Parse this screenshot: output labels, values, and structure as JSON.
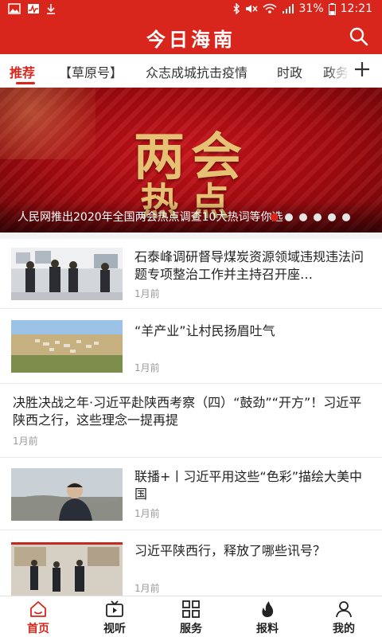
{
  "status_bar": {
    "battery": "31%",
    "time": "12:21"
  },
  "app": {
    "title": "今日海南"
  },
  "tabs": [
    {
      "label": "推荐",
      "active": true
    },
    {
      "label": "【草原号】"
    },
    {
      "label": "众志成城抗击疫情"
    },
    {
      "label": "时政"
    },
    {
      "label": "政务"
    }
  ],
  "banner": {
    "headline_line1": "两会",
    "headline_line2": "热点",
    "caption": "人民网推出2020年全国两会热点调查10大热词等你选",
    "slide_count": 6,
    "active_slide": 0
  },
  "news": [
    {
      "title": "石泰峰调研督导煤炭资源领域违规违法问题专项整治工作并主持召开座…",
      "time": "1月前",
      "thumb": "meeting-photo"
    },
    {
      "title": "“羊产业”让村民扬眉吐气",
      "time": "1月前",
      "thumb": "village-aerial-photo"
    },
    {
      "title": "决胜决战之年·习近平赴陕西考察（四）“鼓劲”“开方”！习近平陕西之行，这些理念一提再提",
      "time": "1月前",
      "thumb": null
    },
    {
      "title": "联播+丨习近平用这些“色彩”描绘大美中国",
      "time": "1月前",
      "thumb": "portrait-photo"
    },
    {
      "title": "习近平陕西行，释放了哪些讯号？",
      "time": "1月前",
      "thumb": "exhibition-photo"
    }
  ],
  "bottom_nav": [
    {
      "label": "首页",
      "icon": "home-icon",
      "active": true
    },
    {
      "label": "视听",
      "icon": "video-icon"
    },
    {
      "label": "服务",
      "icon": "grid-icon"
    },
    {
      "label": "报料",
      "icon": "fire-icon"
    },
    {
      "label": "我的",
      "icon": "person-icon"
    }
  ],
  "colors": {
    "brand_red": "#d8261c",
    "muted_text": "#9a9a9a"
  }
}
